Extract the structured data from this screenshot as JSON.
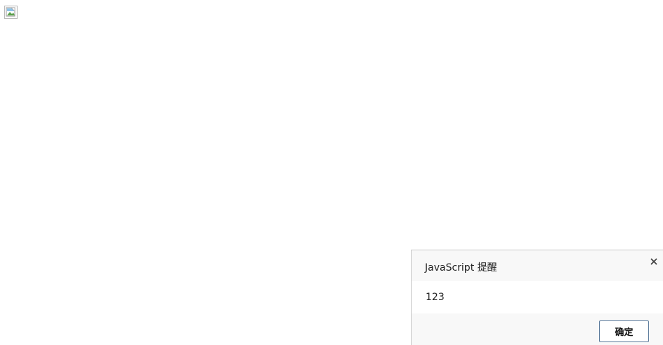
{
  "page": {
    "broken_image_icon": "broken-image-icon"
  },
  "dialog": {
    "title": "JavaScript 提醒",
    "message": "123",
    "ok_label": "确定",
    "close_icon": "close-icon"
  }
}
